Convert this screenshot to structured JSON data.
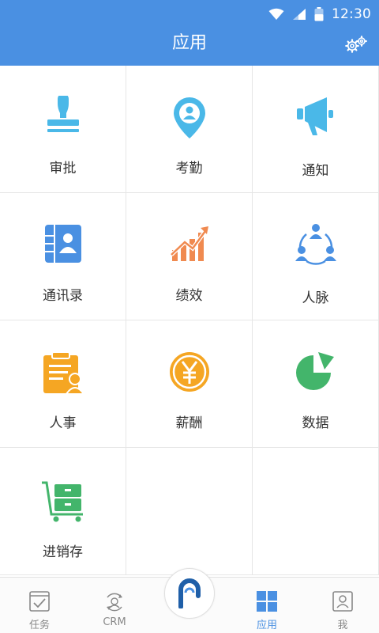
{
  "status": {
    "time": "12:30"
  },
  "header": {
    "title": "应用"
  },
  "apps": [
    {
      "label": "审批"
    },
    {
      "label": "考勤"
    },
    {
      "label": "通知"
    },
    {
      "label": "通讯录"
    },
    {
      "label": "绩效"
    },
    {
      "label": "人脉"
    },
    {
      "label": "人事"
    },
    {
      "label": "薪酬"
    },
    {
      "label": "数据"
    },
    {
      "label": "进销存"
    }
  ],
  "tabs": [
    {
      "label": "任务"
    },
    {
      "label": "CRM"
    },
    {
      "label": "应用"
    },
    {
      "label": "我"
    }
  ],
  "colors": {
    "primary": "#4a90e2",
    "cyan": "#4ab8e8",
    "orange": "#f08a50",
    "amber": "#f5a623",
    "green": "#43b56b"
  }
}
